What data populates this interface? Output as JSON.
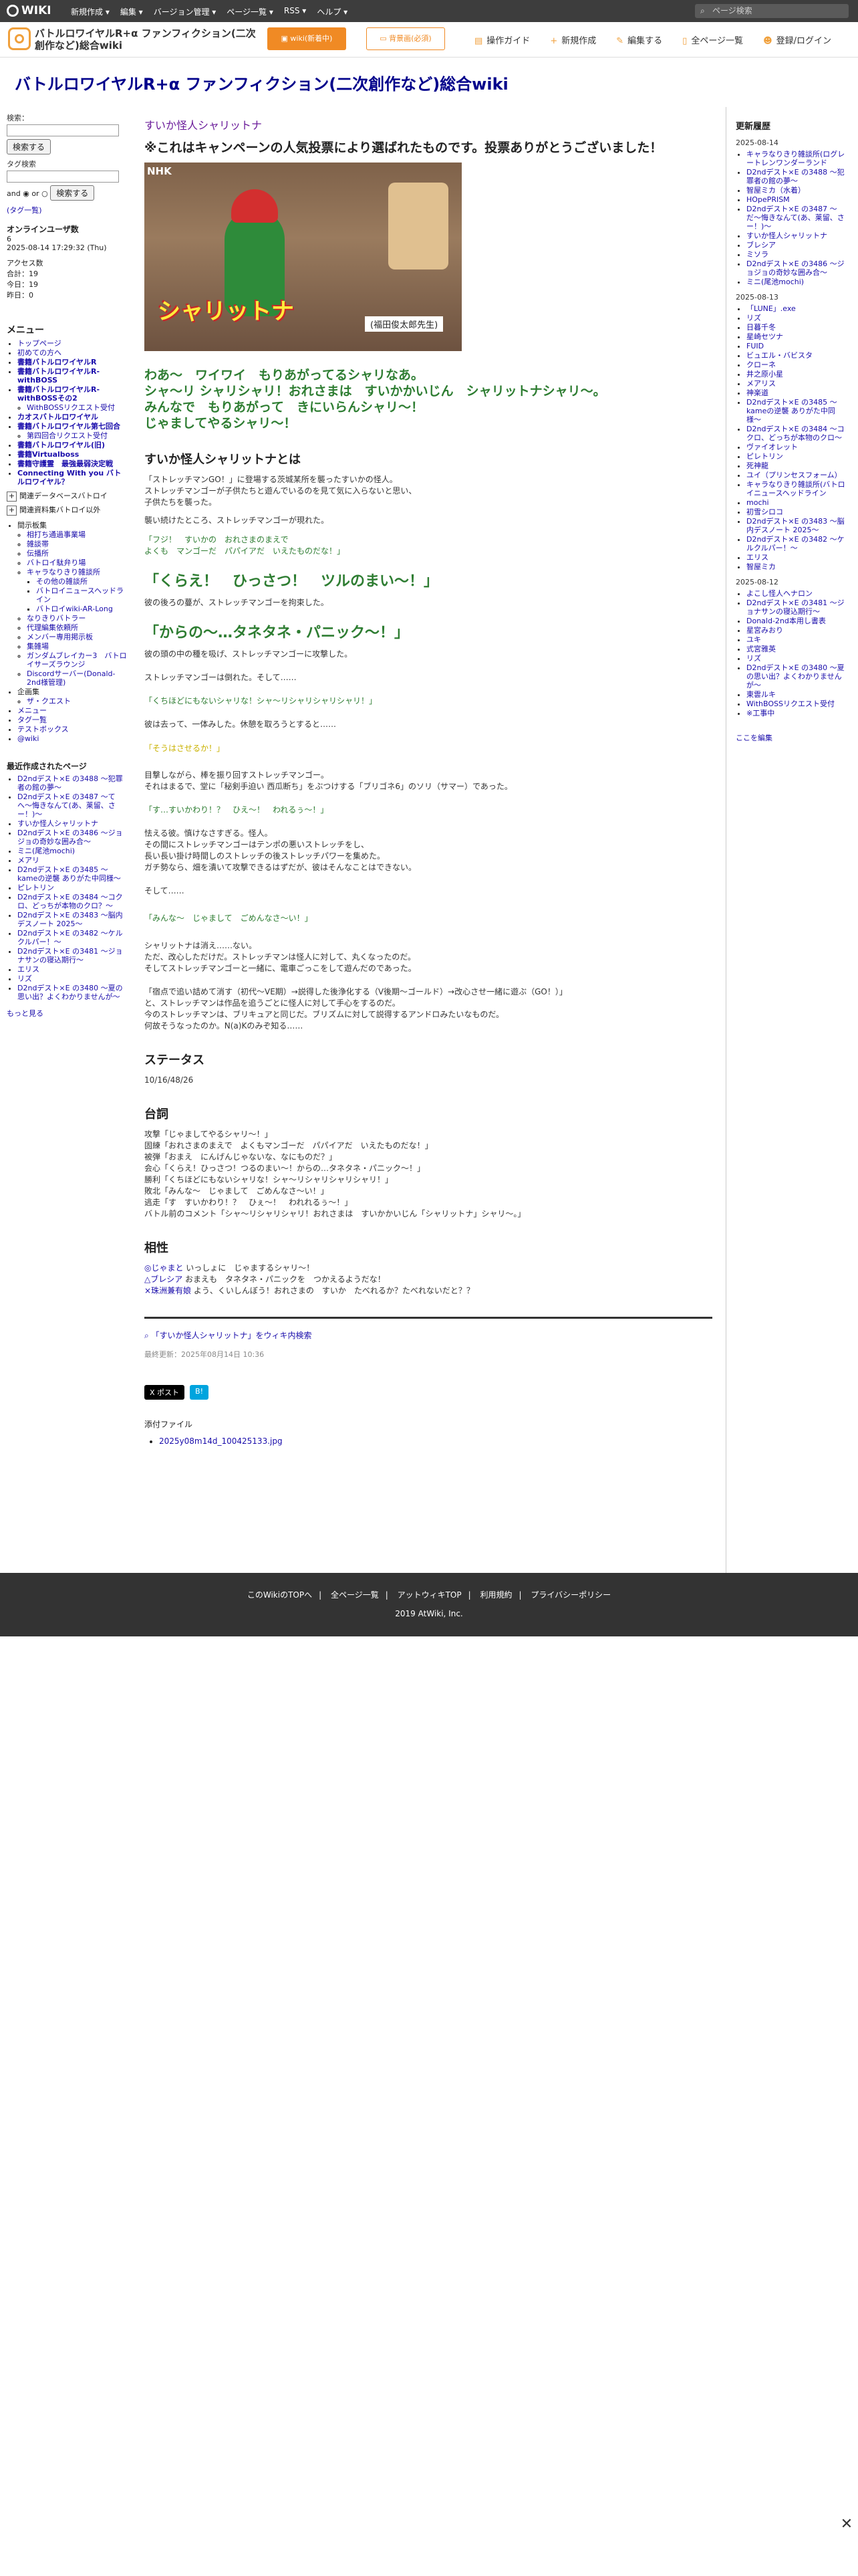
{
  "topbar": {
    "logo": "WIKI",
    "menu": [
      "新規作成 ▾",
      "編集 ▾",
      "バージョン管理 ▾",
      "ページ一覧 ▾",
      "RSS ▾",
      "ヘルプ ▾"
    ],
    "search_placeholder": "ページ検索"
  },
  "header": {
    "site_name": "バトルロワイヤルR+α ファンフィクション(二次創作など)総合wiki",
    "btn_main": "wiki(新着中)",
    "btn_sub": "背景画(必須)",
    "actions": [
      {
        "icon": "book-icon",
        "glyph": "▤",
        "label": "操作ガイド"
      },
      {
        "icon": "plus-icon",
        "glyph": "+",
        "label": "新規作成"
      },
      {
        "icon": "pencil-icon",
        "glyph": "✎",
        "label": "編集する"
      },
      {
        "icon": "page-icon",
        "glyph": "▯",
        "label": "全ページ一覧"
      },
      {
        "icon": "users-icon",
        "glyph": "☻",
        "label": "登録/ログイン"
      }
    ]
  },
  "title": "バトルロワイヤルR+α ファンフィクション(二次創作など)総合wiki",
  "left": {
    "search_label": "検索：",
    "search_btn": "検索する",
    "tag_label": "タグ検索",
    "tag_btn": "検索する",
    "and_label": "and",
    "or_label": "or",
    "tag_list_link": "(タグ一覧)",
    "online_title": "オンラインユーザ数",
    "online_count": "6",
    "timestamp": "2025-08-14 17:29:32 (Thu)",
    "access_title": "アクセス数",
    "access_lines": [
      "合計：19",
      "今日：19",
      "昨日：0"
    ],
    "menu_title": "メニュー",
    "menu_items": [
      {
        "label": "トップページ",
        "bold": false
      },
      {
        "label": "初めての方へ",
        "bold": false
      },
      {
        "label": "書籍バトルロワイヤルR",
        "bold": true
      },
      {
        "label": "書籍バトルロワイヤルR-withBOSS",
        "bold": true
      },
      {
        "label": "書籍バトルロワイヤルR-withBOSSその2",
        "bold": true
      },
      {
        "label": "WithBOSSリクエスト受付",
        "bold": false,
        "sub": true
      },
      {
        "label": "カオスバトルロワイヤル",
        "bold": true
      },
      {
        "label": "書籍バトルロワイヤル第七回合",
        "bold": true
      },
      {
        "label": "第四回合リクエスト受付",
        "bold": false,
        "sub": true
      },
      {
        "label": "書籍バトルロワイヤル(旧)",
        "bold": true
      },
      {
        "label": "書籍Virtualboss",
        "bold": true
      },
      {
        "label": "書籍守護霊　最強最弱決定戦",
        "bold": true
      },
      {
        "label": "Connecting With you バトルロワイヤル？",
        "bold": true
      }
    ],
    "toggle1": "関連データベースバトロイ",
    "toggle2": "関連資料集バトロイ以外",
    "sub_tree_title": "間示板集",
    "sub_tree": [
      "相打ち通過事業場",
      "雑談帯",
      "伝播所",
      "バトロイ駄弁り場",
      "キャラなりきり雑談所",
      "その他の雑談所",
      "バトロイニュースヘッドライン",
      "バトロイwiki-AR-Long",
      "なりきりバトラー",
      "代理編集依頼所",
      "メンバー専用掲示板",
      "集雑場",
      "ガンダムブレイカー3　バトロイサーズラウンジ",
      "Discordサーバー(Donald-2nd様管理)"
    ],
    "fiction_title": "企画集",
    "fiction_items": [
      "ザ・クエスト"
    ],
    "extra_items": [
      "メニュー",
      "タグ一覧",
      "テストボックス",
      "@wiki"
    ],
    "recent_title": "最近作成されたページ",
    "recent_items": [
      "D2ndデスト×E の3488 〜犯罪者の館の夢〜",
      "D2ndデスト×E の3487 〜てへ〜悔きなんて(あ、莱留、さー！)〜",
      "すいか怪人シャリットナ",
      "D2ndデスト×E の3486 〜ジョジョの奇妙な囲み合〜",
      "ミニ(尾池mochi)",
      "メアリ",
      "D2ndデスト×E の3485 〜kameの逆襲 ありがた中同様〜",
      "ピレトリン",
      "D2ndデスト×E の3484 〜コクロ、どっちが本物のクロ？〜",
      "D2ndデスト×E の3483 〜脳内デスノート 2025〜",
      "D2ndデスト×E の3482 〜ケルクルパー！〜",
      "D2ndデスト×E の3481 〜ジョナサンの寝込期行〜",
      "エリス",
      "リズ",
      "D2ndデスト×E の3480 〜夏の思い出？よくわかりませんが〜"
    ],
    "more_link": "もっと見る"
  },
  "main": {
    "sub_title": "すいか怪人シャリットナ",
    "main_title": "※これはキャンペーンの人気投票により選ばれたものです。投票ありがとうございました！",
    "hero_tag": "NHK",
    "hero_caption": "シャリットナ",
    "hero_sensei": "(福田俊太郎先生)",
    "call_lines": [
      "わあ〜　ワイワイ　もりあがってるシャリなあ。",
      "シャ〜リ シャリシャリ！おれさまは　すいかかいじん　シャリットナシャリ〜。",
      "みんなで　もりあがって　きにいらんシャリ〜！",
      "じゃましてやるシャリ〜！"
    ],
    "h2_about": "すいか怪人シャリットナとは",
    "para1": [
      "「ストレッチマンGO！」に登場する茨城某所を襲ったすいかの怪人。",
      "ストレッチマンゴーが子供たちと遊んでいるのを見て気に入らないと思い、",
      "子供たちを襲った。"
    ],
    "para2": "襲い続けたところ、ストレッチマンゴーが現れた。",
    "quote1": [
      "「フジ！　すいかの　おれさまのまえで",
      "よくも　マンゴーだ　パパイアだ　いえたものだな！」"
    ],
    "big1": "「くらえ！　ひっさつ！　ツルのまい〜！」",
    "para3": "彼の後ろの蔓が、ストレッチマンゴーを拘束した。",
    "big2": "「からの〜…タネタネ・パニック〜！」",
    "para4": "彼の頭の中の種を吸げ、ストレッチマンゴーに攻撃した。",
    "para5": "ストレッチマンゴーは倒れた。そして……",
    "quote2": "「くちほどにもないシャリな！シャ〜リシャリシャリシャリ！」",
    "para6": "彼は去って、一体みした。休憩を取ろうとすると……",
    "quote3": "「そうはさせるか！」",
    "para7": [
      "目撃しながら、棒を振り回すストレッチマンゴー。",
      "それはまるで、堂に「秘剣手迫い 西瓜断ち」をぶつけする「ブリゴネ6」のソリ（サマー）であった。"
    ],
    "quote4": "「す…すいかわり！？　ひえ〜！　われるぅ〜！」",
    "para8": [
      "怯える彼。慎けなさすぎる。怪人。",
      "その間にストレッチマンゴーはテンポの悪いストレッチをし、",
      "長い長い掛け時間しのストレッチの後ストレッチパワーを集めた。",
      "ガチ勢なら、畑を潰いて攻撃できるはずだが、彼はそんなことはできない。"
    ],
    "para9": "そして……",
    "quote5": "「みんな〜　じゃまして　ごめんなさ〜い！」",
    "para10": [
      "シャリットナは消え……ない。",
      "ただ、改心しただけだ。ストレッチマンは怪人に対して、丸くなったのだ。",
      "そしてストレッチマンゴーと一緒に、電車ごっこをして遊んだのであった。"
    ],
    "para11": [
      "「宿点で追い詰めて消す（初代〜VE期）→説得した後浄化する（V後期〜ゴールド）→改心させ一緒に遊ぶ（GO！）」",
      "と、ストレッチマンは作品を追うごとに怪人に対して手心をするのだ。",
      "今のストレッチマンは、ブリキュアと同じだ。ブリズムに対して説得するアンドロみたいなものだ。",
      "何故そうなったのか。N(a)Kのみぞ知る……"
    ],
    "h2_status": "ステータス",
    "status": "10/16/48/26",
    "h2_lines": "台詞",
    "lines": [
      "攻撃「じゃましてやるシャリ〜！」",
      "固練「おれさまのまえで　よくもマンゴーだ　パパイアだ　いえたものだな！」",
      "被弾「おまえ　にんげんじゃないな、なにものだ？」",
      "会心「くらえ！ひっさつ！つるのまい〜！からの…タネタネ・パニック〜！」",
      "勝利「くちほどにもないシャリな！シャ〜リシャリシャリシャリ！」",
      "敗北「みんな〜　じゃまして　ごめんなさ〜い！」",
      "逃走「す　すいかわり！？　ひぇ〜！　われれるぅ〜！」",
      "バトル前のコメント「シャ〜リシャリシャリ！おれさまは　すいかかいじん「シャリットナ」シャリ〜。」"
    ],
    "h2_compat": "相性",
    "compat": [
      {
        "link": "◎じゃまと",
        "text": " いっしょに　じゃまするシャリ〜！"
      },
      {
        "link": "△ブレシア",
        "text": " おまえも　タネタネ・パニックを　つかえるようだな！"
      },
      {
        "link": "×珠洲兼有娘",
        "text": " よう、くいしんぼう！おれさまの　すいか　たべれるか？たべれないだと？？"
      }
    ],
    "related": "「すいか怪人シャリットナ」をウィキ内検索",
    "updated": "最終更新：2025年08月14日 10:36",
    "share_x": "X ポスト",
    "share_b": "B!",
    "attach_title": "添付ファイル",
    "attach": "2025y08m14d_100425133.jpg"
  },
  "right": {
    "title": "更新履歴",
    "groups": [
      {
        "date": "2025-08-14",
        "items": [
          "キャラなりきり雑談所(ログレートレンワンダーランド",
          "D2ndデスト×E の3488 〜犯罪者の館の夢〜",
          "智屋ミカ（水着）",
          "HOpePRISM",
          "D2ndデスト×E の3487 〜だ〜悔きなんて(あ、莱留、さー！)〜",
          "すいか怪人シャリットナ",
          "ブレシア",
          "ミソラ",
          "D2ndデスト×E の3486 〜ジョジョの奇妙な囲み合〜",
          "ミニ(尾池mochi)"
        ]
      },
      {
        "date": "2025-08-13",
        "items": [
          "「LUNE」.exe",
          "リズ",
          "日暮千冬",
          "星崎セツナ",
          "FUID",
          "ビュエル・バビスタ",
          "クローネ",
          "井之原小星",
          "メアリス",
          "神楽道",
          "D2ndデスト×E の3485 〜kameの逆襲 ありがた中同様〜",
          "D2ndデスト×E の3484 〜コクロ、どっちが本物のクロ〜",
          "ヴァイオレット",
          "ピレトリン",
          "死神龍",
          "ユイ（プリンセスフォーム）",
          "キャラなりきり雑談所(バトロイニュースヘッドライン",
          "mochi",
          "初雪シロコ",
          "D2ndデスト×E の3483 〜脳内デスノート 2025〜",
          "D2ndデスト×E の3482 〜ケルクルパー！〜",
          "エリス",
          "智屋ミカ"
        ]
      },
      {
        "date": "2025-08-12",
        "items": [
          "よこし怪人ヘナロン",
          "D2ndデスト×E の3481 〜ジョナサンの寝込期行〜",
          "Donald-2nd本用し書表",
          "星宮みおり",
          "ユキ",
          "式宮雅英",
          "リズ",
          "D2ndデスト×E の3480 〜夏の思い出？よくわかりませんが〜",
          "東雲ルキ",
          "WithBOSSリクエスト受付",
          "※工事中"
        ]
      }
    ],
    "edit_link": "ここを編集"
  },
  "footer": {
    "links": [
      "このWikiのTOPへ",
      "全ページ一覧",
      "アットウィキTOP",
      "利用規約",
      "プライバシーポリシー"
    ],
    "copyright": "2019 AtWiki, Inc."
  }
}
